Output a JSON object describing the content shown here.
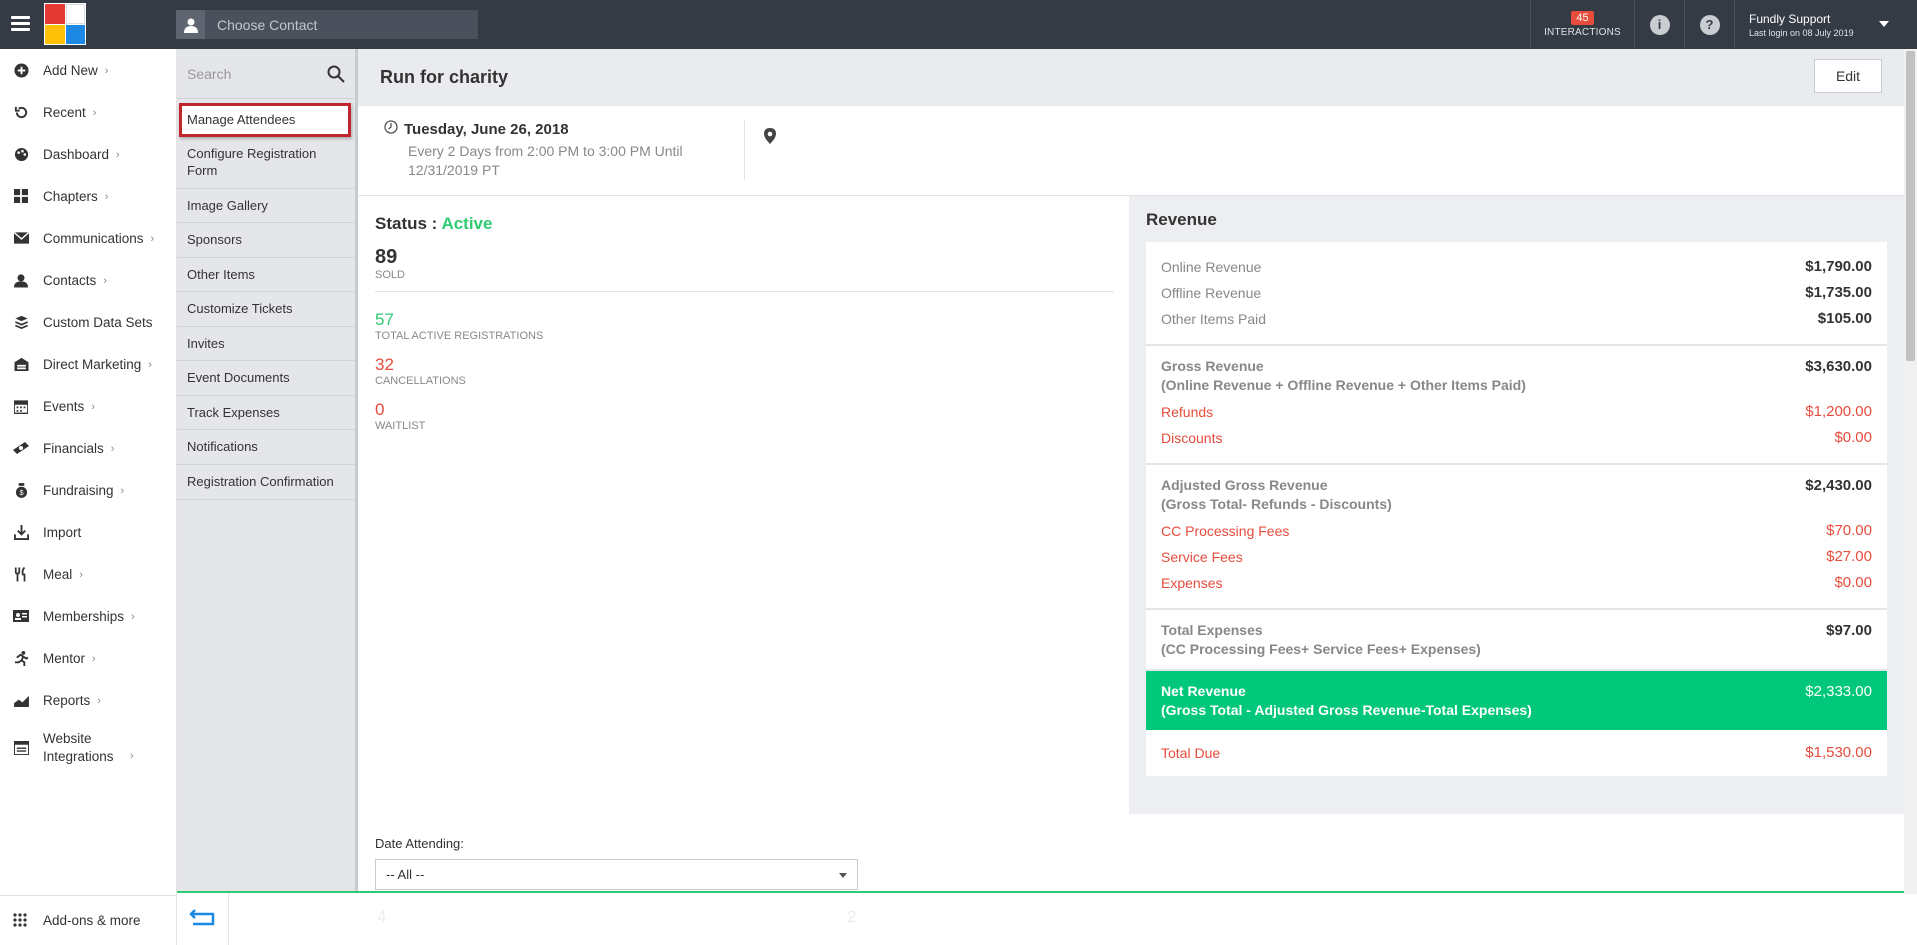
{
  "topbar": {
    "contact_placeholder": "Choose Contact",
    "interactions_count": "45",
    "interactions_label": "INTERACTIONS",
    "user_name": "Fundly Support",
    "last_login": "Last login on 08 July 2019"
  },
  "leftnav": {
    "items": [
      {
        "label": "Add New",
        "icon": "plus-circle-icon"
      },
      {
        "label": "Recent",
        "icon": "history-icon"
      },
      {
        "label": "Dashboard",
        "icon": "palette-icon"
      },
      {
        "label": "Chapters",
        "icon": "grid-icon"
      },
      {
        "label": "Communications",
        "icon": "envelope-icon"
      },
      {
        "label": "Contacts",
        "icon": "person-icon"
      },
      {
        "label": "Custom Data Sets",
        "icon": "layers-icon"
      },
      {
        "label": "Direct Marketing",
        "icon": "building-icon"
      },
      {
        "label": "Events",
        "icon": "calendar-icon"
      },
      {
        "label": "Financials",
        "icon": "cash-icon"
      },
      {
        "label": "Fundraising",
        "icon": "moneybag-icon"
      },
      {
        "label": "Import",
        "icon": "import-icon"
      },
      {
        "label": "Meal",
        "icon": "cutlery-icon"
      },
      {
        "label": "Memberships",
        "icon": "id-card-icon"
      },
      {
        "label": "Mentor",
        "icon": "runner-icon"
      },
      {
        "label": "Reports",
        "icon": "chart-icon"
      },
      {
        "label": "Website Integrations",
        "icon": "browser-icon"
      }
    ],
    "addons_label": "Add-ons & more"
  },
  "subpanel": {
    "search_placeholder": "Search",
    "items": [
      "Manage Attendees",
      "Configure Registration Form",
      "Image Gallery",
      "Sponsors",
      "Other Items",
      "Customize Tickets",
      "Invites",
      "Event Documents",
      "Track Expenses",
      "Notifications",
      "Registration Confirmation"
    ]
  },
  "event": {
    "title": "Run for charity",
    "edit_label": "Edit",
    "date": "Tuesday, June 26, 2018",
    "recurrence": "Every 2 Days from 2:00 PM to 3:00 PM Until 12/31/2019 PT"
  },
  "stats": {
    "status_label": "Status :",
    "status_value": "Active",
    "sold": "89",
    "sold_label": "SOLD",
    "active_regs": "57",
    "active_regs_label": "TOTAL ACTIVE REGISTRATIONS",
    "cancellations": "32",
    "cancellations_label": "CANCELLATIONS",
    "waitlist": "0",
    "waitlist_label": "WAITLIST"
  },
  "revenue": {
    "title": "Revenue",
    "online_label": "Online Revenue",
    "online": "$1,790.00",
    "offline_label": "Offline Revenue",
    "offline": "$1,735.00",
    "other_label": "Other Items Paid",
    "other": "$105.00",
    "gross_label": "Gross Revenue",
    "gross": "$3,630.00",
    "gross_formula": "(Online Revenue + Offline Revenue + Other Items Paid)",
    "refunds_label": "Refunds",
    "refunds": "$1,200.00",
    "discounts_label": "Discounts",
    "discounts": "$0.00",
    "adjusted_label": "Adjusted Gross Revenue",
    "adjusted": "$2,430.00",
    "adjusted_formula": "(Gross Total- Refunds - Discounts)",
    "cc_label": "CC Processing Fees",
    "cc": "$70.00",
    "service_label": "Service Fees",
    "service": "$27.00",
    "expenses_label": "Expenses",
    "expenses": "$0.00",
    "total_exp_label": "Total Expenses",
    "total_exp": "$97.00",
    "total_exp_formula": "(CC Processing Fees+ Service Fees+ Expenses)",
    "net_label": "Net Revenue",
    "net": "$2,333.00",
    "net_formula": "(Gross Total - Adjusted Gross Revenue-Total Expenses)",
    "due_label": "Total Due",
    "due": "$1,530.00"
  },
  "date_attending": {
    "label": "Date Attending:",
    "selected": "-- All --"
  },
  "bottombar": {
    "left_num": "4",
    "right_num": "2"
  },
  "colors": {
    "topbar": "#353b45",
    "accent_green": "#00c77a",
    "status_green": "#2ecc71",
    "alert_red": "#e74c3c",
    "highlight_box": "#c0262d"
  }
}
